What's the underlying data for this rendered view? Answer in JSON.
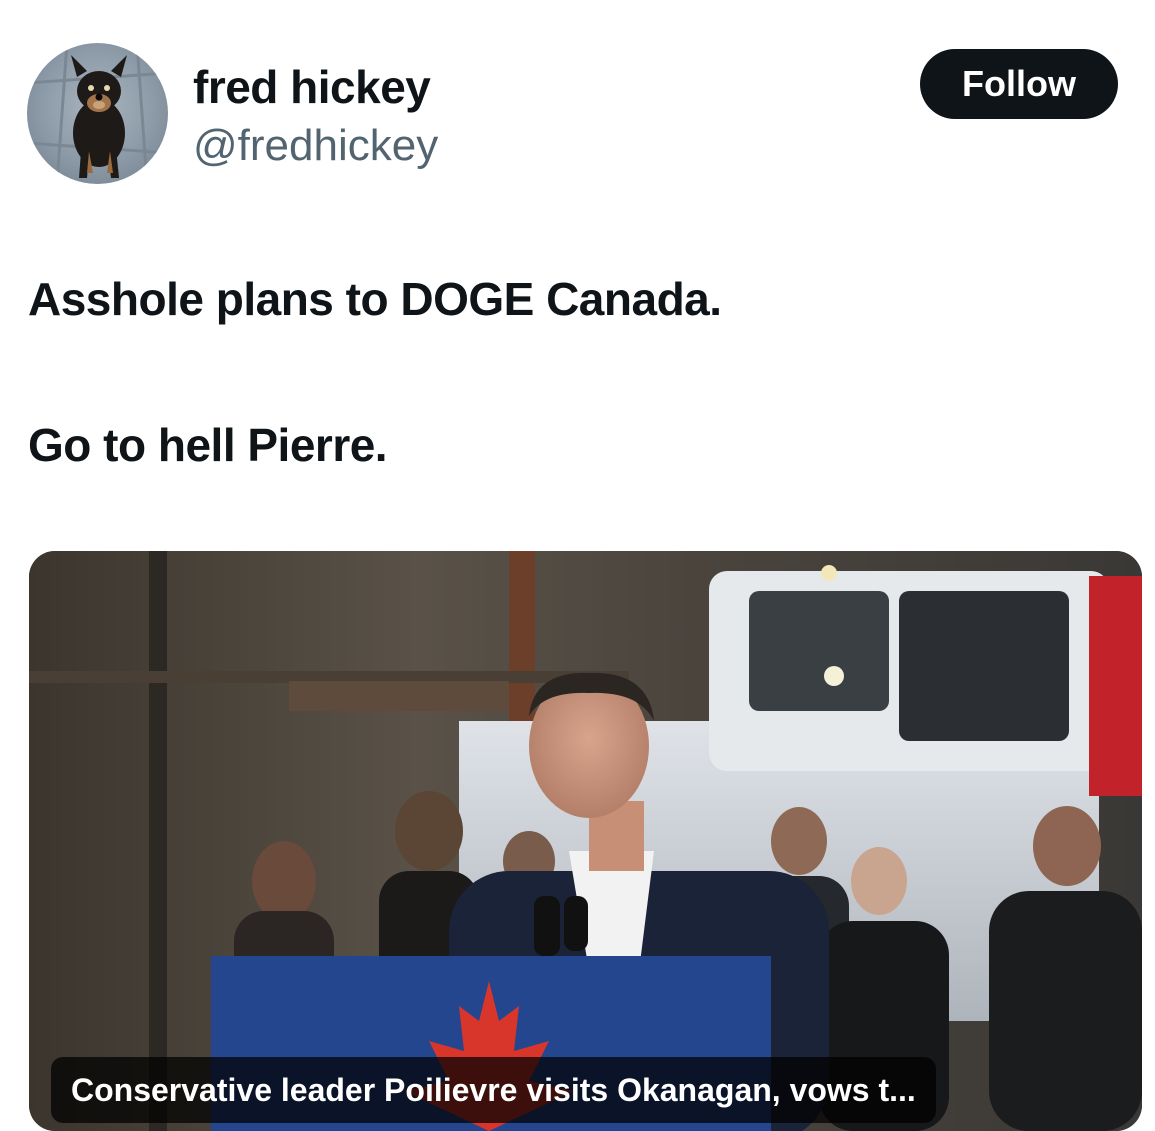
{
  "author": {
    "display_name": "fred hickey",
    "handle": "@fredhickey",
    "avatar_icon": "dog-avatar"
  },
  "follow_button": {
    "label": "Follow"
  },
  "tweet": {
    "lines": [
      "Asshole plans to DOGE Canada.",
      "Go to hell Pierre."
    ]
  },
  "link_card": {
    "caption": "Conservative leader Poilievre visits Okanagan, vows t...",
    "image_icon": "speaker-at-podium-photo"
  },
  "colors": {
    "text": "#0f1419",
    "secondary_text": "#536471",
    "button_bg": "#0f1419",
    "podium_blue": "#24468f",
    "maple_red": "#d8362b"
  }
}
